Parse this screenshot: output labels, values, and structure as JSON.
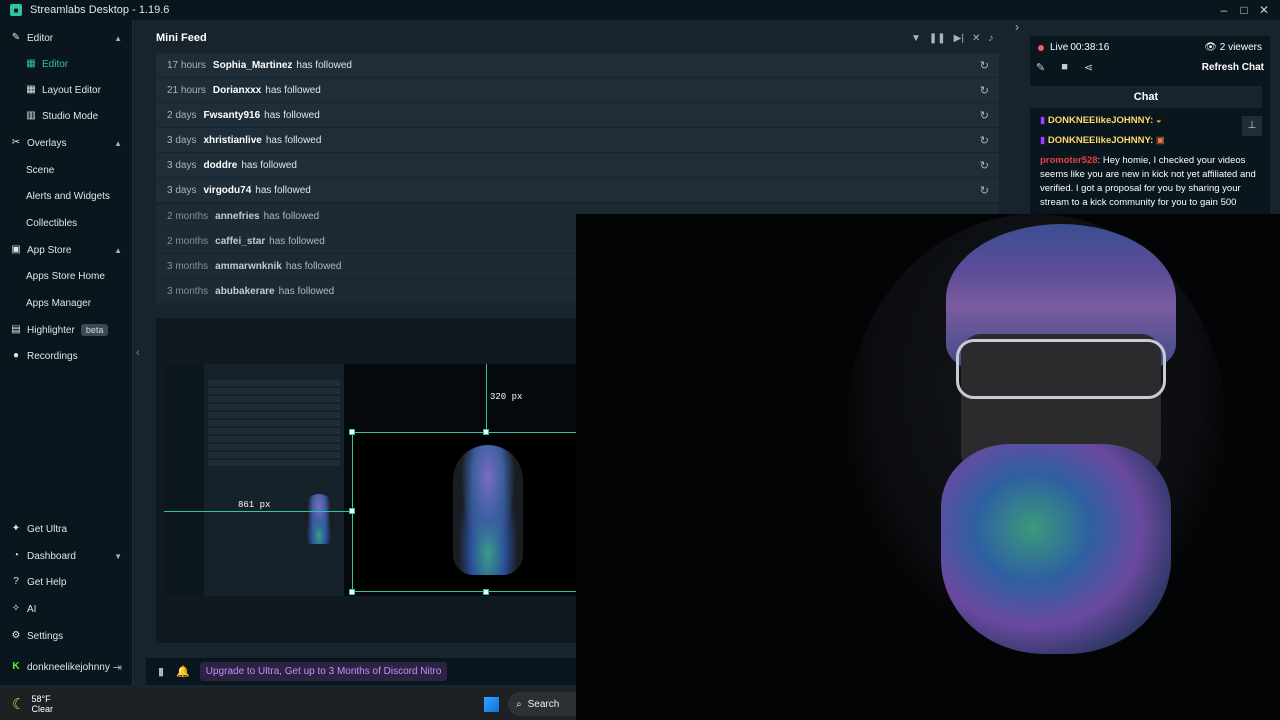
{
  "window": {
    "title": "Streamlabs Desktop - 1.19.6"
  },
  "sidebar": {
    "items": [
      {
        "label": "Editor",
        "type": "section",
        "icon": "brush-icon"
      },
      {
        "label": "Editor",
        "type": "sub",
        "active": true,
        "icon": "edit-icon"
      },
      {
        "label": "Layout Editor",
        "type": "sub",
        "icon": "layout-icon"
      },
      {
        "label": "Studio Mode",
        "type": "sub",
        "icon": "studio-icon"
      },
      {
        "label": "Overlays",
        "type": "section",
        "icon": "paint-icon"
      },
      {
        "label": "Scene",
        "type": "sub"
      },
      {
        "label": "Alerts and Widgets",
        "type": "sub"
      },
      {
        "label": "Collectibles",
        "type": "sub"
      },
      {
        "label": "App Store",
        "type": "section",
        "icon": "store-icon"
      },
      {
        "label": "Apps Store Home",
        "type": "sub"
      },
      {
        "label": "Apps Manager",
        "type": "sub"
      },
      {
        "label": "Highlighter",
        "type": "section",
        "badge": "beta",
        "icon": "highlighter-icon"
      },
      {
        "label": "Recordings",
        "type": "section",
        "icon": "record-icon"
      }
    ],
    "bottom_items": [
      {
        "label": "Get Ultra",
        "icon": "ultra-icon"
      },
      {
        "label": "Dashboard",
        "icon": "dashboard-icon"
      },
      {
        "label": "Get Help",
        "icon": "help-icon"
      },
      {
        "label": "AI",
        "icon": "ai-icon"
      },
      {
        "label": "Settings",
        "icon": "gear-icon"
      },
      {
        "label": "donkneelikejohnny",
        "icon": "kick-icon"
      }
    ]
  },
  "mini_feed": {
    "title": "Mini Feed",
    "rows": [
      {
        "time": "17 hours",
        "user": "Sophia_Martinez",
        "action": "has followed"
      },
      {
        "time": "21 hours",
        "user": "Dorianxxx",
        "action": "has followed"
      },
      {
        "time": "2 days",
        "user": "Fwsanty916",
        "action": "has followed"
      },
      {
        "time": "3 days",
        "user": "xhristianlive",
        "action": "has followed"
      },
      {
        "time": "3 days",
        "user": "doddre",
        "action": "has followed"
      },
      {
        "time": "3 days",
        "user": "virgodu74",
        "action": "has followed"
      },
      {
        "time": "2 months",
        "user": "annefries",
        "action": "has followed"
      },
      {
        "time": "2 months",
        "user": "caffei_star",
        "action": "has followed"
      },
      {
        "time": "3 months",
        "user": "ammarwnknik",
        "action": "has followed"
      },
      {
        "time": "3 months",
        "user": "abubakerare",
        "action": "has followed"
      }
    ]
  },
  "preview": {
    "measure_top": "320 px",
    "measure_left": "861 px"
  },
  "footer": {
    "promo": "Upgrade to Ultra, Get up to 3 Months of Discord Nitro"
  },
  "chat": {
    "live_label": "Live",
    "live_time": "00:38:16",
    "viewers": "2 viewers",
    "refresh": "Refresh Chat",
    "tab": "Chat",
    "messages": [
      {
        "name": "DONKNEElikeJOHNNY:",
        "text": ""
      },
      {
        "name": "DONKNEElikeJOHNNY:",
        "text": ""
      },
      {
        "name": "promoter528",
        "text": ": Hey homie, I checked your videos seems like you are new in kick not yet affiliated and verified. I got a proposal for you by sharing your stream to a kick community for you to gain 500"
      }
    ]
  },
  "taskbar": {
    "temp": "58°F",
    "condition": "Clear",
    "search": "Search"
  }
}
